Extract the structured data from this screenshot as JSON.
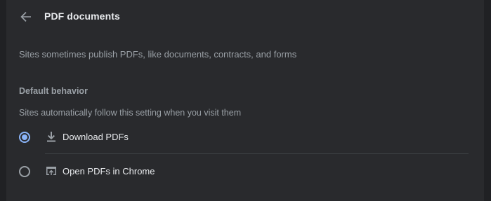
{
  "header": {
    "title": "PDF documents",
    "back_icon": "arrow-back-icon"
  },
  "description": "Sites sometimes publish PDFs, like documents, contracts, and forms",
  "default_behavior": {
    "heading": "Default behavior",
    "subheading": "Sites automatically follow this setting when you visit them",
    "selected": "download",
    "options": [
      {
        "id": "download",
        "label": "Download PDFs",
        "icon": "download-icon",
        "checked": true
      },
      {
        "id": "open",
        "label": "Open PDFs in Chrome",
        "icon": "open-in-browser-icon",
        "checked": false
      }
    ]
  },
  "colors": {
    "background": "#202124",
    "card": "#292a2d",
    "accent": "#8ab4f8",
    "text_primary": "#e8eaed",
    "text_secondary": "#9aa0a6"
  }
}
